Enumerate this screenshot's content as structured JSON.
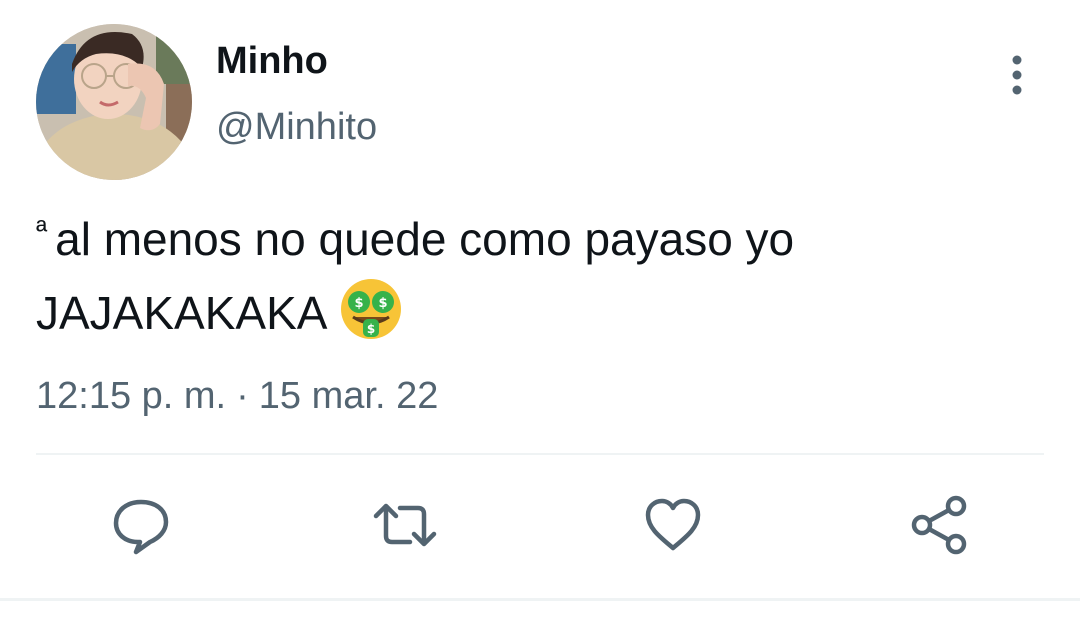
{
  "author": {
    "display_name": "Minho",
    "handle": "@Minhito",
    "avatar": "profile-photo"
  },
  "tweet": {
    "superscript": "ª",
    "line1": "al menos no quede como payaso yo",
    "line2": "JAJAKAKAKA",
    "emoji": "money-mouth-face"
  },
  "meta": {
    "time": "12:15 p. m.",
    "separator": "·",
    "date": "15 mar. 22"
  },
  "actions": [
    {
      "name": "reply",
      "icon": "comment-icon"
    },
    {
      "name": "retweet",
      "icon": "retweet-icon"
    },
    {
      "name": "like",
      "icon": "heart-icon"
    },
    {
      "name": "share",
      "icon": "share-icon"
    }
  ],
  "menu": {
    "icon": "more-vertical-icon"
  },
  "colors": {
    "text": "#0f1419",
    "secondary": "#536471",
    "divider": "#eff3f4",
    "emoji_face": "#f7c437",
    "emoji_money": "#36b24a"
  }
}
